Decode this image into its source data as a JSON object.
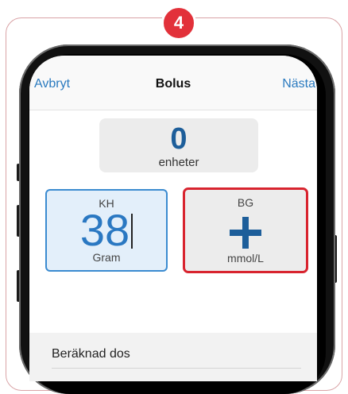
{
  "step": {
    "number": "4",
    "color": "#e2313a"
  },
  "navbar": {
    "cancel_label": "Avbryt",
    "title": "Bolus",
    "next_label": "Nästa"
  },
  "units": {
    "value": "0",
    "label": "enheter"
  },
  "carbs": {
    "label": "KH",
    "value": "38",
    "unit": "Gram"
  },
  "glucose": {
    "label": "BG",
    "unit": "mmol/L",
    "add_icon": "plus-icon",
    "highlight_color": "#d8242f"
  },
  "calculation": {
    "row_label": "Beräknad dos"
  }
}
